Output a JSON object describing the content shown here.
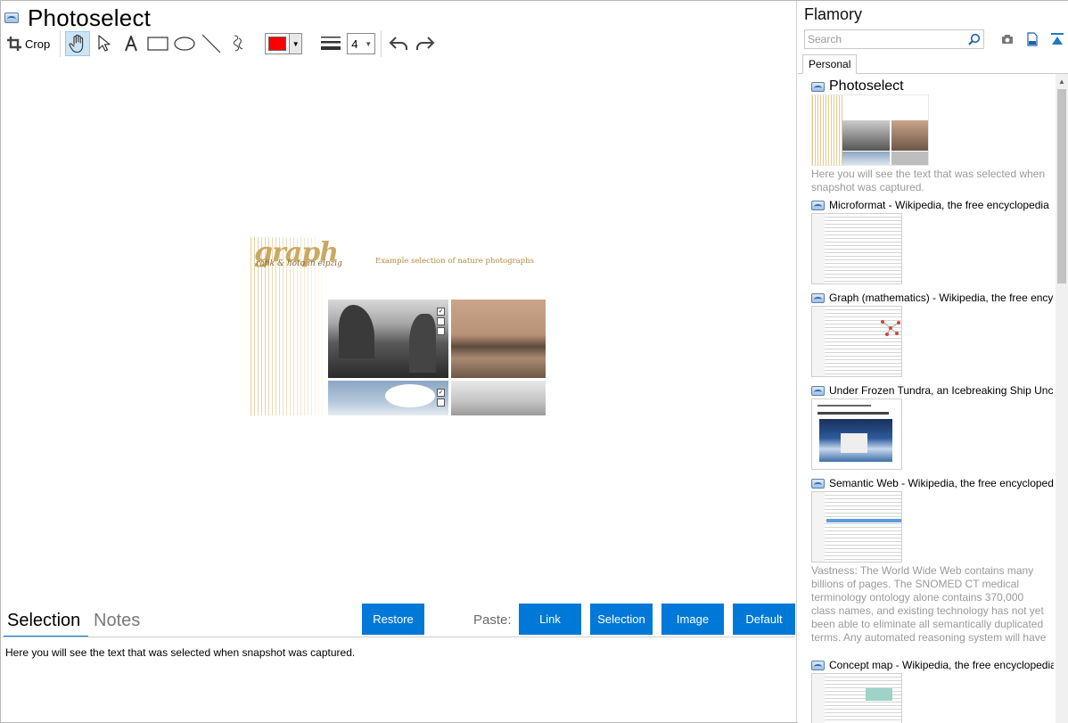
{
  "document": {
    "title": "Photoselect"
  },
  "toolbar": {
    "crop_label": "Crop",
    "stroke_color": "#ff0000",
    "stroke_width": "4"
  },
  "snapshot": {
    "logo": "graph",
    "logo_sub": "rafik & hoto in eipzig",
    "caption": "Example selection of nature photographs"
  },
  "bottom": {
    "tab_selection": "Selection",
    "tab_notes": "Notes",
    "restore_label": "Restore",
    "paste_label": "Paste:",
    "link_label": "Link",
    "selection_label": "Selection",
    "image_label": "Image",
    "default_label": "Default",
    "selection_text": "Here you will see the text that was selected when snapshot was captured."
  },
  "sidebar": {
    "title": "Flamory",
    "search_placeholder": "Search",
    "tab_personal": "Personal",
    "items": [
      {
        "title": "Photoselect",
        "desc": "Here you will see the text that was selected when snapshot was captured."
      },
      {
        "title": "Microformat - Wikipedia, the free encyclopedia"
      },
      {
        "title": "Graph (mathematics) - Wikipedia, the free encyclopedia"
      },
      {
        "title": "Under Frozen Tundra, an Icebreaking Ship Uncovers"
      },
      {
        "title": "Semantic Web - Wikipedia, the free encyclopedia",
        "desc": "Vastness: The World Wide Web contains many billions of pages. The SNOMED CT medical terminology ontology alone contains 370,000 class names, and existing technology has not yet been able to eliminate all semantically duplicated terms. Any automated reasoning system will have to deal with truly huge inputs."
      },
      {
        "title": "Concept map - Wikipedia, the free encyclopedia"
      }
    ]
  },
  "colors": {
    "accent": "#0078d7",
    "active_tool": "#cce4f7"
  }
}
